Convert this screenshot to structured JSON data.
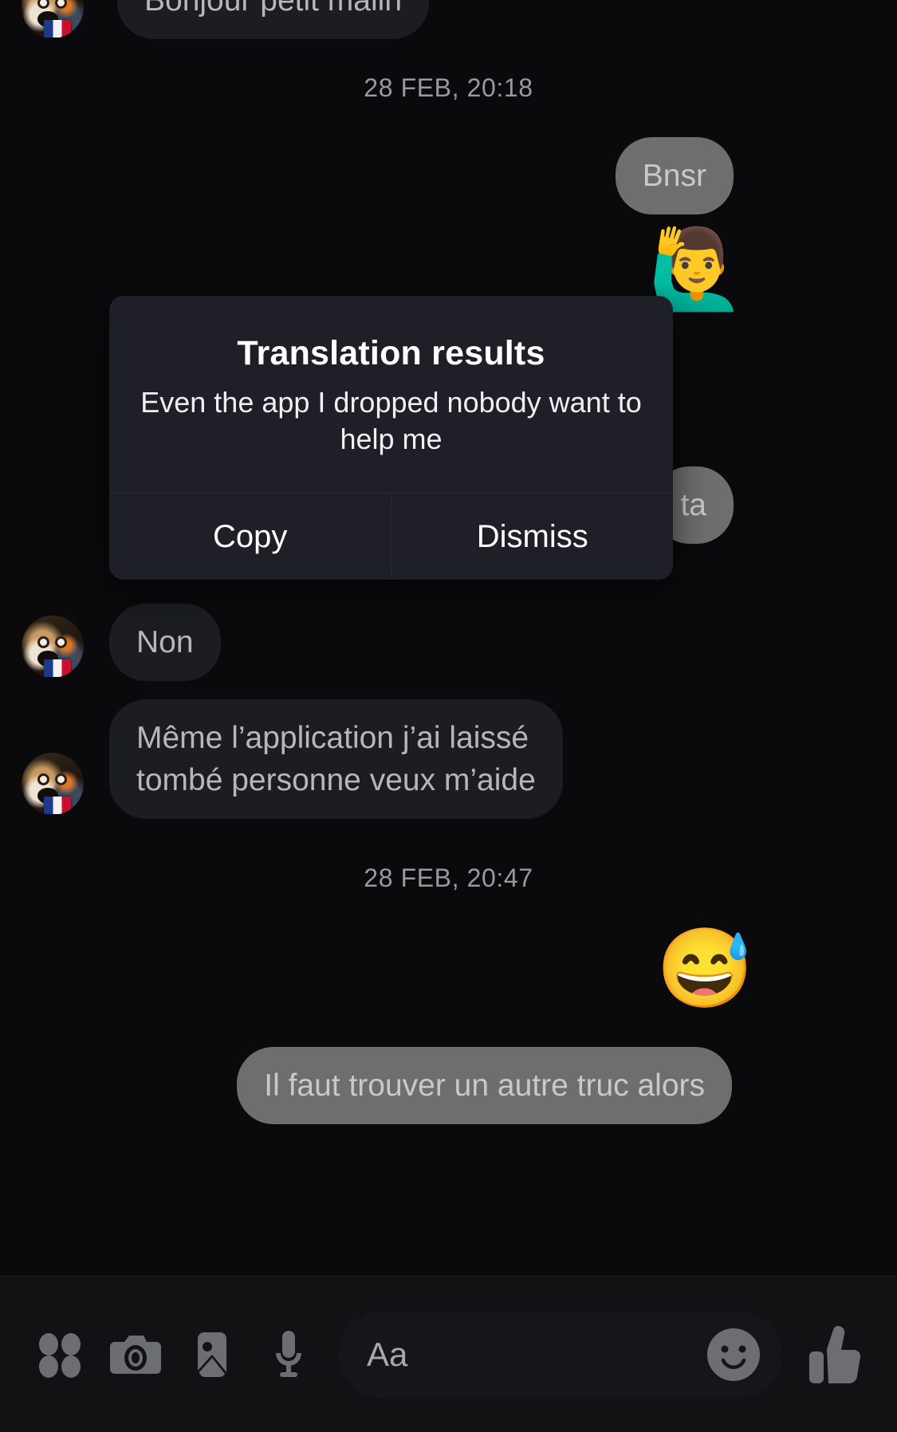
{
  "app": {
    "name": "Messenger chat thread",
    "theme": "dark",
    "colors": {
      "background": "#0a0a0c",
      "incoming_bubble": "#1c1d22",
      "outgoing_bubble": "#6e6e6e",
      "dialog_surface": "#1e1f27",
      "dialog_divider": "#2b2c36",
      "toolbar_background": "#121214",
      "icon_tint": "#6d6e72",
      "timestamp_text": "#9a9a9e"
    }
  },
  "thread": {
    "messages": [
      {
        "id": "m1",
        "direction": "incoming",
        "text": "Bonjour petit malin",
        "clipped_top": true,
        "has_avatar": true
      },
      {
        "id": "m2",
        "direction": "outgoing",
        "text": "Bnsr"
      },
      {
        "id": "m3",
        "direction": "outgoing",
        "text": "🙋‍♂️",
        "is_emoji_only": true
      },
      {
        "id": "m4",
        "direction": "outgoing",
        "text": "ta",
        "partially_covered_by_dialog": true
      },
      {
        "id": "m5",
        "direction": "incoming",
        "text": "Non",
        "has_avatar": true
      },
      {
        "id": "m6",
        "direction": "incoming",
        "text": "Même l’application j’ai laissé\ntombé personne veux m’aide",
        "has_avatar": true
      },
      {
        "id": "m7",
        "direction": "outgoing",
        "text": "😅",
        "is_emoji_only": true
      },
      {
        "id": "m8",
        "direction": "outgoing",
        "text": "Il faut trouver un autre truc alors"
      }
    ],
    "timestamps": [
      {
        "id": "t1",
        "label": "28 FEB, 20:18"
      },
      {
        "id": "t2",
        "label": "28 FEB, 20:47"
      }
    ]
  },
  "dialog": {
    "title": "Translation results",
    "message": "Even the app I dropped nobody want to help me",
    "buttons": [
      {
        "id": "copy",
        "label": "Copy"
      },
      {
        "id": "dismiss",
        "label": "Dismiss"
      }
    ]
  },
  "toolbar": {
    "icons": [
      {
        "id": "apps",
        "name": "four-dots-grid-icon",
        "label": "Apps"
      },
      {
        "id": "camera",
        "name": "camera-icon",
        "label": "Camera"
      },
      {
        "id": "gallery",
        "name": "image-icon",
        "label": "Gallery"
      },
      {
        "id": "mic",
        "name": "microphone-icon",
        "label": "Voice message"
      }
    ],
    "composer": {
      "placeholder_glyph": "Aa",
      "value": "",
      "emoji_button": "smiley-icon"
    },
    "send_shortcut": {
      "name": "thumbs-up-icon",
      "label": "Like"
    }
  }
}
